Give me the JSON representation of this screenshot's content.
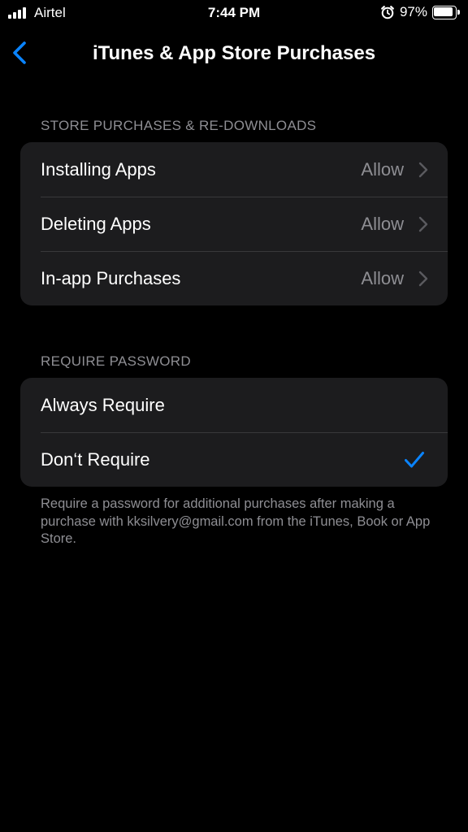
{
  "status_bar": {
    "carrier": "Airtel",
    "time": "7:44 PM",
    "battery_percent_label": "97%",
    "battery_level": 0.97,
    "icons": [
      "signal-icon",
      "alarm-icon",
      "battery-icon"
    ]
  },
  "nav": {
    "back_icon": "chevron-left-icon",
    "title": "iTunes & App Store Purchases",
    "accent_color": "#0a84ff"
  },
  "store_section": {
    "header": "STORE PURCHASES & RE-DOWNLOADS",
    "rows": [
      {
        "label": "Installing Apps",
        "value": "Allow"
      },
      {
        "label": "Deleting Apps",
        "value": "Allow"
      },
      {
        "label": "In-app Purchases",
        "value": "Allow"
      }
    ]
  },
  "password_section": {
    "header": "REQUIRE PASSWORD",
    "rows": [
      {
        "label": "Always Require",
        "selected": false
      },
      {
        "label": "Don‘t Require",
        "selected": true
      }
    ],
    "footer": "Require a password for additional purchases after making a purchase with kksilvery@gmail.com from the iTunes, Book or App Store."
  }
}
